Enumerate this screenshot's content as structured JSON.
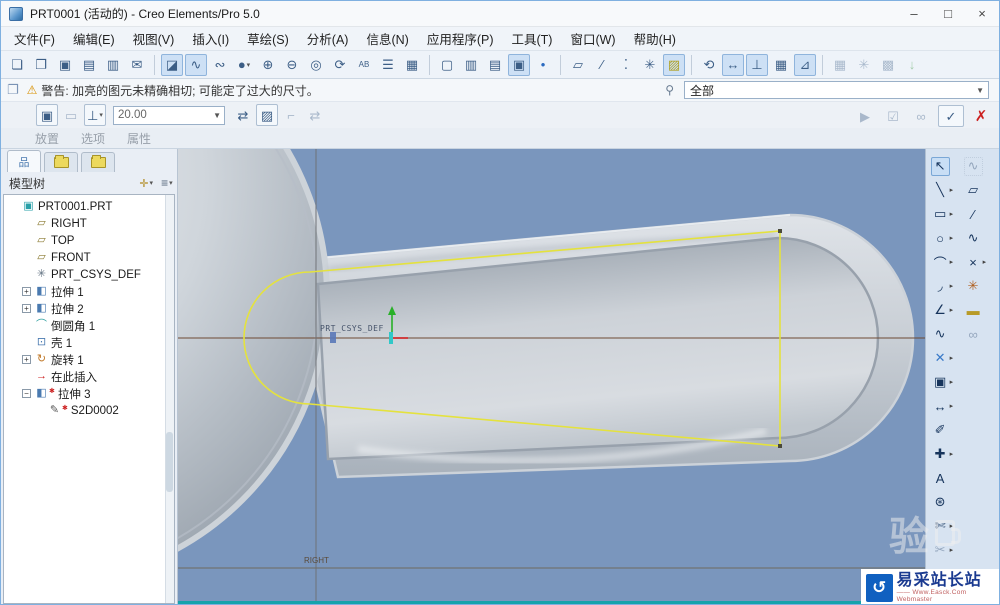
{
  "window": {
    "title": "PRT0001 (活动的) - Creo Elements/Pro 5.0",
    "minimize": "–",
    "maximize": "□",
    "close": "×"
  },
  "menu": {
    "items": [
      {
        "t": "文件(F)",
        "n": "menu-file"
      },
      {
        "t": "编辑(E)",
        "n": "menu-edit"
      },
      {
        "t": "视图(V)",
        "n": "menu-view"
      },
      {
        "t": "插入(I)",
        "n": "menu-insert"
      },
      {
        "t": "草绘(S)",
        "n": "menu-sketch"
      },
      {
        "t": "分析(A)",
        "n": "menu-analysis"
      },
      {
        "t": "信息(N)",
        "n": "menu-info"
      },
      {
        "t": "应用程序(P)",
        "n": "menu-applications"
      },
      {
        "t": "工具(T)",
        "n": "menu-tools"
      },
      {
        "t": "窗口(W)",
        "n": "menu-window"
      },
      {
        "t": "帮助(H)",
        "n": "menu-help"
      }
    ]
  },
  "toolbar": {
    "groups": [
      [
        {
          "n": "new-file",
          "g": "❏"
        },
        {
          "n": "open-file",
          "g": "❐"
        },
        {
          "n": "save-file",
          "g": "▣"
        },
        {
          "n": "print",
          "g": "▤"
        },
        {
          "n": "print-setup",
          "g": "▥"
        },
        {
          "n": "send-email",
          "g": "✉"
        }
      ],
      [
        {
          "n": "sketch-view",
          "g": "◪",
          "s": "pressed"
        },
        {
          "n": "sketch-setup",
          "g": "∿",
          "s": "pressed"
        },
        {
          "n": "render-settings",
          "g": "∾"
        },
        {
          "n": "shaded-sphere",
          "g": "●",
          "fly": true
        },
        {
          "n": "zoom-in",
          "g": "⊕"
        },
        {
          "n": "zoom-out",
          "g": "⊖"
        },
        {
          "n": "zoom-fit",
          "g": "◎"
        },
        {
          "n": "view-orient",
          "g": "⟳"
        },
        {
          "n": "saved-views",
          "g": "AB"
        },
        {
          "n": "layers",
          "g": "☰"
        },
        {
          "n": "view-manager",
          "g": "▦"
        }
      ],
      [
        {
          "n": "wireframe-display",
          "g": "▢"
        },
        {
          "n": "hidden-line-display",
          "g": "▥"
        },
        {
          "n": "no-hidden-display",
          "g": "▤"
        },
        {
          "n": "shaded-display",
          "g": "▣",
          "s": "pressed"
        },
        {
          "n": "spin-center",
          "g": "•",
          "c": "#2a6ac0"
        }
      ],
      [
        {
          "n": "plane-display",
          "g": "▱"
        },
        {
          "n": "axis-display",
          "g": "⁄"
        },
        {
          "n": "point-display",
          "g": "⁚"
        },
        {
          "n": "csys-display",
          "g": "✳"
        },
        {
          "n": "shade-closed-loops",
          "g": "▨",
          "s": "pressed",
          "c": "#b0a020"
        }
      ],
      [
        {
          "n": "sketch-orient",
          "g": "⟲"
        },
        {
          "n": "dim-display",
          "g": "↔",
          "s": "pressed"
        },
        {
          "n": "constraint-display",
          "g": "⊥",
          "s": "pressed"
        },
        {
          "n": "grid-display",
          "g": "▦"
        },
        {
          "n": "vertex-display",
          "g": "⊿",
          "s": "pressed"
        }
      ],
      [
        {
          "n": "highlight-open-ends",
          "g": "▦",
          "s": "grayed"
        },
        {
          "n": "overlap-geometry",
          "g": "✳",
          "s": "grayed"
        },
        {
          "n": "lock-modified-dims",
          "g": "▩",
          "s": "grayed"
        },
        {
          "n": "import-geometry",
          "g": "↓",
          "s": "grayed",
          "c": "#2a8a2a"
        }
      ]
    ]
  },
  "warning": {
    "text": "警告: 加亮的图元未精确相切; 可能定了过大的尺寸。",
    "filter_value": "全部"
  },
  "dashboard": {
    "left1": [
      {
        "n": "placement-collector",
        "g": "▣",
        "box": true
      },
      {
        "n": "sketch-collector",
        "g": "▭",
        "s": "grayed"
      },
      {
        "n": "depth-type",
        "g": "⊥",
        "box": true,
        "fly": true
      }
    ],
    "value": "20.00",
    "left2": [
      {
        "n": "flip-depth-direction",
        "g": "⇄"
      },
      {
        "n": "remove-material",
        "g": "▨",
        "box": true,
        "s": "pressed"
      },
      {
        "n": "thicken-sketch",
        "g": "⌐",
        "s": "grayed"
      },
      {
        "n": "flip-thicken-side",
        "g": "⇄",
        "s": "grayed"
      }
    ],
    "right": [
      {
        "n": "resume",
        "g": "▶",
        "s": "grayed"
      },
      {
        "n": "verify",
        "g": "☑",
        "s": "grayed"
      },
      {
        "n": "preview-glasses",
        "g": "∞",
        "s": "grayed"
      },
      {
        "n": "apply",
        "g": "✓",
        "box": true
      },
      {
        "n": "cancel",
        "g": "✗",
        "red": true
      }
    ],
    "tabs": [
      {
        "t": "放置",
        "n": "panel-placement"
      },
      {
        "t": "选项",
        "n": "panel-options"
      },
      {
        "t": "属性",
        "n": "panel-properties"
      }
    ]
  },
  "model_tree": {
    "title": "模型树",
    "tabs": [
      {
        "n": "model-tree-tab",
        "g": "品",
        "active": true
      },
      {
        "n": "folder-browser-tab",
        "folder": true
      },
      {
        "n": "favorites-tab",
        "folder": true
      }
    ],
    "header_buttons": [
      {
        "n": "tree-filters",
        "g": "✛"
      },
      {
        "n": "tree-settings",
        "g": "≡"
      }
    ],
    "items": [
      {
        "label": "PRT0001.PRT",
        "icon": "▣",
        "c": "#2aa0a8",
        "indent": 0,
        "n": "tree-item-part"
      },
      {
        "label": "RIGHT",
        "icon": "▱",
        "c": "#8a7a30",
        "indent": 1,
        "n": "tree-item-right-plane"
      },
      {
        "label": "TOP",
        "icon": "▱",
        "c": "#8a7a30",
        "indent": 1,
        "n": "tree-item-top-plane"
      },
      {
        "label": "FRONT",
        "icon": "▱",
        "c": "#8a7a30",
        "indent": 1,
        "n": "tree-item-front-plane"
      },
      {
        "label": "PRT_CSYS_DEF",
        "icon": "✳",
        "c": "#607080",
        "indent": 1,
        "n": "tree-item-csys"
      },
      {
        "label": "拉伸 1",
        "icon": "◧",
        "c": "#4a7ab0",
        "indent": 1,
        "exp": "+",
        "n": "tree-item-extrude-1"
      },
      {
        "label": "拉伸 2",
        "icon": "◧",
        "c": "#4a7ab0",
        "indent": 1,
        "exp": "+",
        "n": "tree-item-extrude-2"
      },
      {
        "label": "倒圆角 1",
        "icon": "⌒",
        "c": "#30a0a0",
        "indent": 1,
        "n": "tree-item-round-1"
      },
      {
        "label": "壳 1",
        "icon": "⊡",
        "c": "#4a7ab0",
        "indent": 1,
        "n": "tree-item-shell-1"
      },
      {
        "label": "旋转 1",
        "icon": "↻",
        "c": "#c07828",
        "indent": 1,
        "exp": "+",
        "n": "tree-item-revolve-1"
      },
      {
        "label": "在此插入",
        "icon": "→",
        "c": "#cc2020",
        "indent": 1,
        "n": "tree-item-insert-here"
      },
      {
        "label": "拉伸 3",
        "icon": "◧",
        "c": "#4a7ab0",
        "indent": 1,
        "exp": "-",
        "flag": true,
        "n": "tree-item-extrude-3"
      },
      {
        "label": "S2D0002",
        "icon": "✎",
        "c": "#555555",
        "indent": 2,
        "flag": true,
        "n": "tree-item-sketch-s2d0002"
      }
    ]
  },
  "right_toolbar": {
    "rows": [
      {
        "a": {
          "n": "select",
          "g": "↖",
          "s": "selected"
        },
        "b": {
          "n": "region-select",
          "g": "∿",
          "s": "grayed",
          "dotted": true
        }
      },
      {
        "a": {
          "n": "line",
          "g": "╲",
          "fly": true
        },
        "b": {
          "n": "parallelogram",
          "g": "▱"
        }
      },
      {
        "a": {
          "n": "rectangle",
          "g": "▭",
          "fly": true
        },
        "b": {
          "n": "centerline",
          "g": "⁄"
        }
      },
      {
        "a": {
          "n": "circle",
          "g": "○",
          "fly": true
        },
        "b": {
          "n": "conic-curve",
          "g": "∿"
        }
      },
      {
        "a": {
          "n": "arc",
          "g": "⌒",
          "fly": true
        },
        "b": {
          "n": "point-pair",
          "g": "×",
          "fly": true
        }
      },
      {
        "a": {
          "n": "fillet",
          "g": "◞",
          "fly": true
        },
        "b": {
          "n": "coord-system",
          "g": "✳",
          "c": "#b06020"
        }
      },
      {
        "a": {
          "n": "chamfer",
          "g": "∠",
          "fly": true
        },
        "b": {
          "n": "perimeter-dim",
          "g": "▬",
          "c": "#b89b28"
        }
      },
      {
        "a": {
          "n": "spline",
          "g": "∿"
        },
        "b": {
          "n": "link",
          "g": "∞",
          "s": "grayed"
        }
      },
      {
        "a": {
          "n": "point",
          "g": "✕",
          "c": "#3a7ac8",
          "fly": true
        },
        "b": null
      },
      {
        "a": {
          "n": "use-edge",
          "g": "▣",
          "fly": true
        },
        "b": null
      },
      {
        "a": {
          "n": "dimension",
          "g": "↔",
          "fly": true
        },
        "b": null
      },
      {
        "a": {
          "n": "modify-dims",
          "g": "✐"
        },
        "b": null
      },
      {
        "a": {
          "n": "constraints",
          "g": "✚",
          "fly": true
        },
        "b": null
      },
      {
        "a": {
          "n": "text",
          "g": "A"
        },
        "b": null
      },
      {
        "a": {
          "n": "palette",
          "g": "⊛"
        },
        "b": null
      },
      {
        "a": {
          "n": "trim-delete",
          "g": "✄",
          "fly": true
        },
        "b": null
      },
      {
        "a": {
          "n": "corner-trim",
          "g": "✂",
          "s": "grayed",
          "fly": true
        },
        "b": null
      },
      {
        "a": {
          "n": "sketch-done",
          "g": "✓",
          "c": "#222222"
        },
        "b": null
      }
    ]
  },
  "canvas": {
    "csys_label": "PRT_CSYS_DEF",
    "plane_label": "RIGHT",
    "background": "#7a96bd",
    "sketch_color": "#e4e23e",
    "datum_line_color": "#6e4a34"
  },
  "watermark": {
    "stamp": "验",
    "site": "易采站长站",
    "sub": "—— Www.Easck.Com Webmaster"
  }
}
